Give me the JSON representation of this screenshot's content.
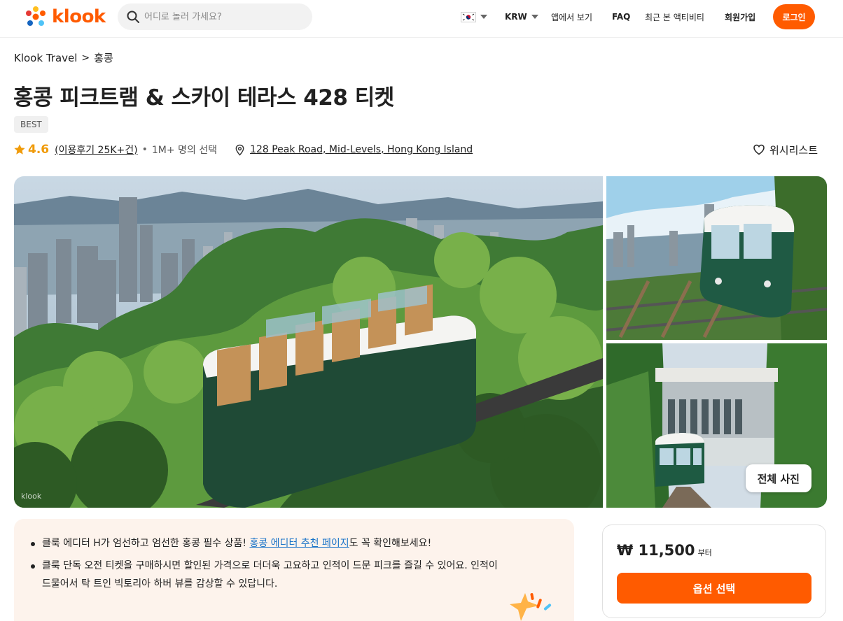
{
  "header": {
    "logo_text": "klook",
    "search_placeholder": "어디로 놀러 가세요?",
    "currency": "KRW",
    "app_link": "앱에서 보기",
    "faq": "FAQ",
    "recent": "최근 본 액티비티",
    "signup": "회원가입",
    "login": "로그인"
  },
  "breadcrumb": {
    "root": "Klook Travel",
    "separator": ">",
    "current": "홍콩"
  },
  "activity": {
    "title": "홍콩 피크트램 & 스카이 테라스 428 티켓",
    "badge": "BEST",
    "rating": "4.6",
    "reviews": "(이용후기 25K+건)",
    "separator": "•",
    "booked": "1M+ 명의 선택",
    "address": "128 Peak Road, Mid-Levels, Hong Kong Island",
    "wishlist": "위시리스트"
  },
  "gallery": {
    "watermark": "klook",
    "all_photos": "전체 사진"
  },
  "highlights": {
    "item1_before": "클룩 에디터 H가 엄선하고 엄선한 홍콩 필수 상품! ",
    "item1_link": "홍콩 에디터 추천 페이지",
    "item1_after": "도 꼭 확인해보세요!",
    "item2": "클룩 단독 오전 티켓을 구매하시면 할인된 가격으로 더더욱 고요하고 인적이 드문 피크를 즐길 수 있어요. 인적이 드물어서 탁 트인 빅토리아 하버 뷰를 감상할 수 있답니다."
  },
  "booking": {
    "price": "₩ 11,500",
    "price_suffix": "부터",
    "select_button": "옵션 선택"
  },
  "colors": {
    "brand": "#ff5b00",
    "rating": "#f09b0a",
    "link": "#1a73c8"
  }
}
